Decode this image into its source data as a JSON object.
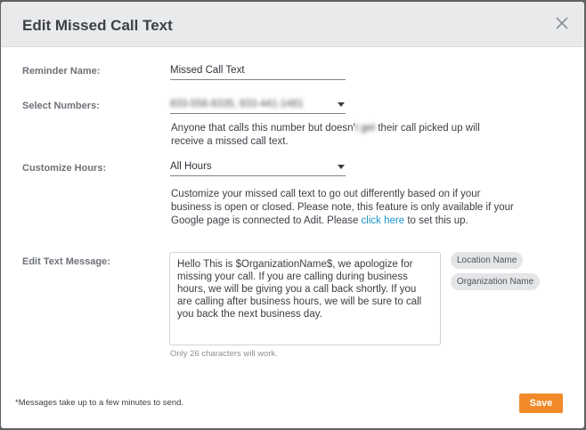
{
  "modal": {
    "title": "Edit Missed Call Text"
  },
  "reminder_name": {
    "label": "Reminder Name:",
    "value": "Missed Call Text"
  },
  "select_numbers": {
    "label": "Select Numbers:",
    "value": "833-558-8335, 833-441-1481",
    "help_before": "Anyone that calls this number but doesn'",
    "help_blur": "t get",
    "help_after": " their call picked up will",
    "help_line2": "receive a missed call text."
  },
  "customize_hours": {
    "label": "Customize Hours:",
    "value": "All Hours",
    "help_line1": "Customize your missed call text to go out differently based on if your",
    "help_line2": "business is open or closed. Please note, this feature is only available if your",
    "help_line3_before": "Google page is connected to Adit. Please ",
    "help_link": "click here",
    "help_line3_after": " to set this up."
  },
  "text_message": {
    "label": "Edit Text Message:",
    "value": "Hello This is $OrganizationName$, we apologize for missing your call. If you are calling during business hours, we will be giving you a call back shortly. If you are calling after business hours, we will be sure to call you back the next business day.",
    "note": "Only 26 characters will work.",
    "tags": [
      "Location Name",
      "Organization Name"
    ]
  },
  "footer": {
    "note": "*Messages take up to a few minutes to send.",
    "save_label": "Save"
  },
  "colors": {
    "accent": "#f28a2a",
    "link": "#1a94c8"
  },
  "icons": {
    "close": "close-icon",
    "dropdown": "chevron-down-icon"
  }
}
